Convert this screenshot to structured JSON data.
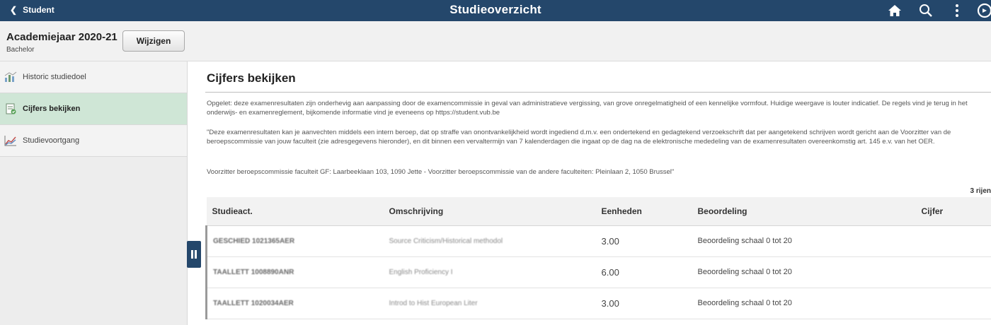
{
  "topbar": {
    "back_label": "Student",
    "title": "Studieoverzicht",
    "icons": [
      "home-icon",
      "search-icon",
      "more-vertical-icon",
      "navbar-icon"
    ],
    "color": "#24476b"
  },
  "subheader": {
    "academic_year": "Academiejaar 2020-21",
    "level": "Bachelor",
    "change_button": "Wijzigen"
  },
  "sidebar": {
    "items": [
      {
        "label": "Historic studiedoel",
        "icon": "timeline-icon",
        "active": false
      },
      {
        "label": "Cijfers bekijken",
        "icon": "grades-icon",
        "active": true
      },
      {
        "label": "Studievoortgang",
        "icon": "chart-line-icon",
        "active": false
      }
    ],
    "active_color": "#cfe6d6"
  },
  "main": {
    "title": "Cijfers bekijken",
    "paragraph1": "Opgelet: deze examenresultaten zijn onderhevig aan aanpassing door de examencommissie in geval van administratieve vergissing, van grove onregelmatigheid of een kennelijke vormfout. Huidige weergave is louter indicatief. De regels vind je terug in het onderwijs- en examenreglement, bijkomende informatie vind je eveneens op https://student.vub.be",
    "paragraph2": "\"Deze examenresultaten kan je aanvechten middels een intern beroep, dat op straffe van onontvankelijkheid wordt ingediend d.m.v. een ondertekend en gedagtekend verzoekschrift dat per aangetekend schrijven wordt gericht aan de Voorzitter van de beroepscommissie van jouw faculteit (zie adresgegevens hieronder), en dit binnen een vervaltermijn van 7 kalenderdagen die ingaat op de dag na de elektronische mededeling van de examenresultaten overeenkomstig art. 145 e.v. van het OER.",
    "paragraph3": "Voorzitter beroepscommissie faculteit GF: Laarbeeklaan 103, 1090 Jette - Voorzitter beroepscommissie van de andere faculteiten: Pleinlaan 2, 1050 Brussel\"",
    "row_count": "3 rijen"
  },
  "table": {
    "headers": [
      "Studieact.",
      "Omschrijving",
      "Eenheden",
      "Beoordeling",
      "Cijfer"
    ],
    "rows": [
      {
        "code": "GESCHIED 1021365AER",
        "description": "Source Criticism/Historical methodol",
        "units": "3.00",
        "grading": "Beoordeling schaal 0 tot 20",
        "grade": ""
      },
      {
        "code": "TAALLETT 1008890ANR",
        "description": "English Proficiency I",
        "units": "6.00",
        "grading": "Beoordeling schaal 0 tot 20",
        "grade": ""
      },
      {
        "code": "TAALLETT 1020034AER",
        "description": "Introd to Hist European Liter",
        "units": "3.00",
        "grading": "Beoordeling schaal 0 tot 20",
        "grade": ""
      }
    ]
  }
}
